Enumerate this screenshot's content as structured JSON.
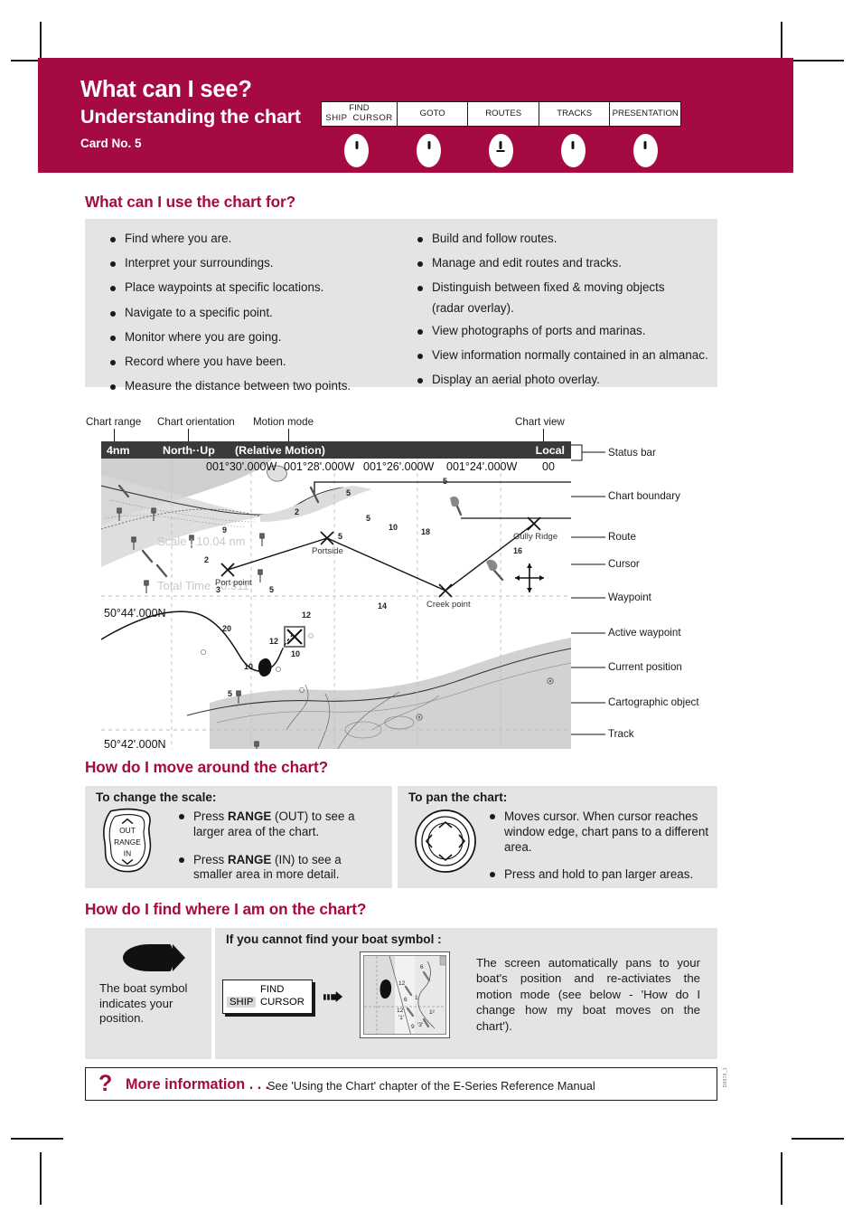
{
  "brand": {
    "crimson": "#a50a43",
    "panel_grey": "#e4e4e4",
    "statusbar_grey": "#3a3a3a"
  },
  "header": {
    "title": "What can I see?",
    "subtitle": "Understanding the chart",
    "card_no": "Card No. 5",
    "softkeys": [
      {
        "line1": "FIND",
        "line2_a": "SHIP",
        "line2_b": "CURSOR",
        "name": "find-ship-cursor"
      },
      {
        "label": "GOTO",
        "name": "goto"
      },
      {
        "label": "ROUTES",
        "name": "routes"
      },
      {
        "label": "TRACKS",
        "name": "tracks"
      },
      {
        "label": "PRESENTATION",
        "name": "presentation"
      }
    ]
  },
  "section_use": {
    "heading": "What can I use the chart for?",
    "left_bullets": [
      "Find where you are.",
      "Interpret your surroundings.",
      "Place waypoints at specific locations.",
      "Navigate to a specific point.",
      "Monitor where you are going.",
      "Record where you have been.",
      "Measure the distance between two points."
    ],
    "right_bullets": [
      "Build and follow routes.",
      "Manage and edit routes and tracks.",
      "Distinguish between fixed & moving objects",
      "(radar overlay).",
      "View photographs of ports and marinas.",
      "View information normally contained in an almanac.",
      "Display an aerial photo overlay."
    ]
  },
  "chart": {
    "top_callouts": {
      "chart_range": "Chart range",
      "chart_orientation": "Chart orientation",
      "motion_mode": "Motion mode",
      "chart_view": "Chart view"
    },
    "statusbar": {
      "range": "4nm",
      "orientation": "North··Up",
      "motion": "(Relative Motion)",
      "view": "Local"
    },
    "right_callouts": [
      "Status bar",
      "Chart boundary",
      "Route",
      "Cursor",
      "Waypoint",
      "Active waypoint",
      "Current position",
      "Cartographic object",
      "Track"
    ],
    "longitude_labels": [
      "001°30'.000W",
      "001°28'.000W",
      "001°26'.000W",
      "001°24'.000W",
      "00"
    ],
    "latitude_labels": [
      "50°44'.000N",
      "50°42'.000N"
    ],
    "waypoint_names": [
      "Port point",
      "Portside",
      "Creek point",
      "Gully Ridge"
    ],
    "overlay_text": {
      "scale": "Scale : 10.04 nm",
      "total_time": "Total Time : 0.311"
    },
    "depth_soundings": [
      "2",
      "9",
      "5",
      "5",
      "5",
      "10",
      "18",
      "16",
      "2",
      "3",
      "5",
      "14",
      "12",
      "20",
      "12",
      "10",
      "10",
      "5",
      "12"
    ]
  },
  "section_move": {
    "heading": "How do I move around the chart?",
    "scale_box": {
      "title": "To change the scale:",
      "keypad": {
        "out": "OUT",
        "range": "RANGE",
        "in": "IN"
      },
      "bullets": [
        {
          "pre": "Press ",
          "key": "RANGE",
          "post": " (OUT) to see a larger area of the chart."
        },
        {
          "pre": "Press ",
          "key": "RANGE",
          "post": " (IN) to see a smaller area in more detail."
        }
      ]
    },
    "pan_box": {
      "title": "To pan the chart:",
      "bullets": [
        "Moves cursor.  When cursor reaches window edge, chart pans to a different area.",
        "Press and hold to pan larger areas."
      ]
    }
  },
  "section_find": {
    "heading": "How do I find where I am on the chart?",
    "boat_caption": "The boat symbol indicates your position.",
    "cannot_find_title": "If you cannot find your boat symbol :",
    "findship_button": {
      "find": "FIND",
      "ship": "SHIP",
      "cursor": "CURSOR"
    },
    "explanation": "The screen automatically pans to your boat's position and re-activiates the motion mode (see below - 'How do I change how my boat moves on the chart')."
  },
  "footer": {
    "qmark": "?",
    "more_information": "More information . . .",
    "reference": "See 'Using the Chart' chapter of the E-Series Reference Manual",
    "side_code": "D8976_1"
  }
}
